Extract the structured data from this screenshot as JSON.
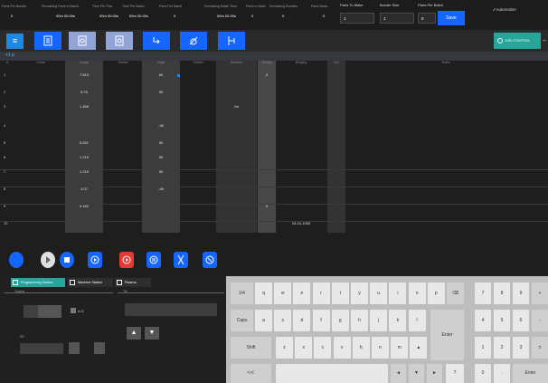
{
  "status": {
    "items": [
      {
        "label": "Parts Per Bundle",
        "value": "0"
      },
      {
        "label": "Remaining Parts In Batch",
        "value": "00m 00.00s"
      },
      {
        "label": "Time Per Part",
        "value": "00m 00.00s"
      },
      {
        "label": "Time Per Batch",
        "value": "00m 00.00s"
      },
      {
        "label": "Parts Per Batch",
        "value": "0"
      },
      {
        "label": "Remaining Batch Time",
        "value": "00m 00.00s"
      },
      {
        "label": "Parts to Make",
        "value": "0"
      },
      {
        "label": "Remaining Bundles",
        "value": "0"
      },
      {
        "label": "Parts Made",
        "value": "0"
      }
    ],
    "inputs": [
      {
        "label": "Parts To Make",
        "value": "1"
      },
      {
        "label": "Bundle Size",
        "value": "1"
      },
      {
        "label": "Parts Per Batch",
        "value": "0"
      }
    ],
    "save_label": "Save",
    "brand": "Automation"
  },
  "toolbar": {
    "menu_icon": "hamburger-icon",
    "job_control_label": "JOB CONTROL",
    "buttons": [
      "program-icon",
      "tool-icon",
      "tool-alt-icon",
      "return-icon",
      "offset-icon",
      "clamp-icon"
    ]
  },
  "strip": {
    "tag": "+1 p"
  },
  "grid": {
    "columns": [
      "#",
      "Grade",
      "Length",
      "Grades",
      "Angle",
      "Grades",
      "Direction",
      "Tooling",
      "Bringing",
      "Unit",
      "Notes"
    ],
    "rows": [
      {
        "n": "1",
        "length": "7.813",
        "angle": "60",
        "direction": "",
        "tooling": "0",
        "bringing": ""
      },
      {
        "n": "2",
        "length": "8.75",
        "angle": "90",
        "direction": "",
        "tooling": "",
        "bringing": ""
      },
      {
        "n": "3",
        "length": "1.469",
        "angle": "",
        "direction": "On",
        "tooling": "",
        "bringing": ""
      },
      {
        "n": "4",
        "length": "",
        "angle": "-45",
        "direction": "",
        "tooling": "",
        "bringing": ""
      },
      {
        "n": "5",
        "length": "5.531",
        "angle": "30",
        "direction": "",
        "tooling": "",
        "bringing": ""
      },
      {
        "n": "6",
        "length": "1.219",
        "angle": "90",
        "direction": "",
        "tooling": "",
        "bringing": ""
      },
      {
        "n": "7",
        "length": "1.219",
        "angle": "90",
        "direction": "",
        "tooling": "",
        "bringing": ""
      },
      {
        "n": "8",
        "length": "3.07",
        "angle": "-45",
        "direction": "",
        "tooling": "",
        "bringing": ""
      },
      {
        "n": "9",
        "length": "0.182",
        "angle": "",
        "direction": "",
        "tooling": "0",
        "bringing": ""
      },
      {
        "n": "10",
        "length": "",
        "angle": "",
        "direction": "",
        "tooling": "",
        "bringing": "15-24-1000"
      }
    ]
  },
  "actions": [
    "cycle-icon",
    "play-icon",
    "stop-icon",
    "step-forward-icon",
    "jog-icon",
    "pause-icon",
    "scissors-icon",
    "reset-icon"
  ],
  "panel": {
    "tabs": [
      "Programming Station",
      "Machine Station",
      "Plasma"
    ],
    "tooling_label": "Tooling",
    "tool_label": "A-S",
    "tilt_label": "Tilt",
    "grade_label": "Grade",
    "reverse_label": "R/F"
  },
  "keyboard": {
    "row1": [
      "1/4",
      "q",
      "w",
      "e",
      "r",
      "t",
      "y",
      "u",
      "i",
      "o",
      "p",
      "⌫"
    ],
    "row2": [
      "Caps",
      "a",
      "s",
      "d",
      "f",
      "g",
      "h",
      "j",
      "k",
      "l"
    ],
    "row3": [
      "Shift",
      "z",
      "x",
      "c",
      "v",
      "b",
      "n",
      "m",
      "▲"
    ],
    "row4": [
      "<>/.",
      "",
      " ",
      "◄",
      "▼",
      "►",
      "?"
    ],
    "enter": "Enter",
    "numpad": [
      [
        "7",
        "8",
        "9",
        "+"
      ],
      [
        "4",
        "5",
        "6",
        "-"
      ],
      [
        "1",
        "2",
        "3",
        "±"
      ],
      [
        "0",
        ".",
        "Enter"
      ]
    ]
  },
  "colors": {
    "accent": "#1565ff",
    "teal": "#26a69a",
    "red": "#e53935"
  }
}
